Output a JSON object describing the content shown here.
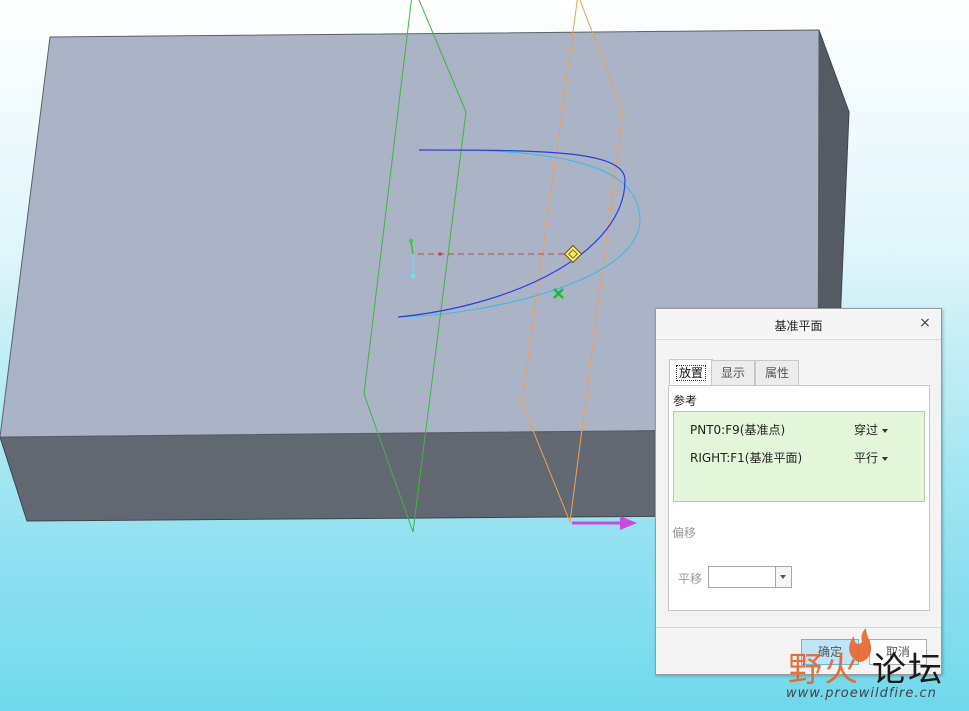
{
  "dialog": {
    "title": "基准平面",
    "close_glyph": "×",
    "tabs": [
      {
        "label": "放置",
        "active": true
      },
      {
        "label": "显示",
        "active": false
      },
      {
        "label": "属性",
        "active": false
      }
    ],
    "references_label": "参考",
    "references": [
      {
        "name": "PNT0:F9(基准点)",
        "constraint": "穿过"
      },
      {
        "name": "RIGHT:F1(基准平面)",
        "constraint": "平行"
      }
    ],
    "offset_label": "偏移",
    "translate_label": "平移",
    "translate_value": "",
    "ok_label": "确定",
    "cancel_label": "取消"
  },
  "watermark": {
    "text_a": "野火",
    "text_b": "论坛",
    "url": "www.proewildfire.cn"
  },
  "colors": {
    "block_top": "#aab4c6",
    "block_front": "#626872",
    "block_side": "#555b63",
    "green_plane": "#3cb83c",
    "orange_plane": "#f0a050",
    "curve_dark": "#2a3ee0",
    "curve_light": "#3cb8ea",
    "drag_arrow": "#c84ae0",
    "ok_button": "#bfe4f7"
  }
}
